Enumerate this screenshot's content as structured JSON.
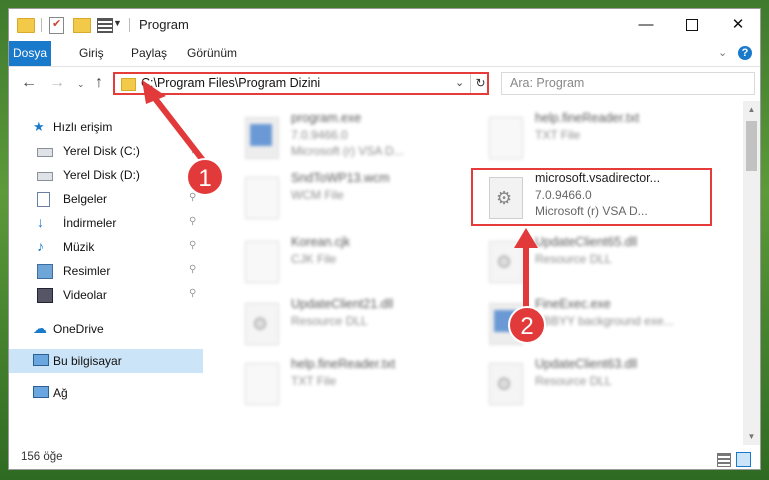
{
  "window": {
    "title": "Program"
  },
  "ribbon": {
    "tabs": [
      "Dosya",
      "Giriş",
      "Paylaş",
      "Görünüm"
    ]
  },
  "address": {
    "path": "C:\\Program Files\\Program Dizini",
    "search_placeholder": "Ara: Program"
  },
  "nav": {
    "quick_access": "Hızlı erişim",
    "items": [
      {
        "label": "Yerel Disk (C:)",
        "icon": "drive-icon"
      },
      {
        "label": "Yerel Disk (D:)",
        "icon": "drive-icon"
      },
      {
        "label": "Belgeler",
        "icon": "documents-icon"
      },
      {
        "label": "İndirmeler",
        "icon": "download-icon"
      },
      {
        "label": "Müzik",
        "icon": "music-icon"
      },
      {
        "label": "Resimler",
        "icon": "pictures-icon"
      },
      {
        "label": "Videolar",
        "icon": "videos-icon"
      }
    ],
    "onedrive": "OneDrive",
    "this_pc": "Bu bilgisayar",
    "network": "Ağ"
  },
  "files": [
    {
      "name": "program.exe",
      "line1": "7.0.9466.0",
      "line2": "Microsoft (r) VSA D..."
    },
    {
      "name": "help.fineReader.txt",
      "line1": "TXT File",
      "line2": ""
    },
    {
      "name": "SndToWP13.wcm",
      "line1": "WCM File",
      "line2": ""
    },
    {
      "name": "microsoft.vsadirector...",
      "line1": "7.0.9466.0",
      "line2": "Microsoft (r) VSA D..."
    },
    {
      "name": "Korean.cjk",
      "line1": "CJK File",
      "line2": ""
    },
    {
      "name": "UpdateClient65.dll",
      "line1": "Resource DLL",
      "line2": ""
    },
    {
      "name": "UpdateClient21.dll",
      "line1": "Resource DLL",
      "line2": ""
    },
    {
      "name": "FineExec.exe",
      "line1": "ABBYY background exe...",
      "line2": ""
    },
    {
      "name": "help.fineReader.txt",
      "line1": "TXT File",
      "line2": ""
    },
    {
      "name": "UpdateClient63.dll",
      "line1": "Resource DLL",
      "line2": ""
    }
  ],
  "status": {
    "count": "156 öğe"
  },
  "annotations": {
    "marker1": "1",
    "marker2": "2",
    "color": "#e23a3a"
  }
}
